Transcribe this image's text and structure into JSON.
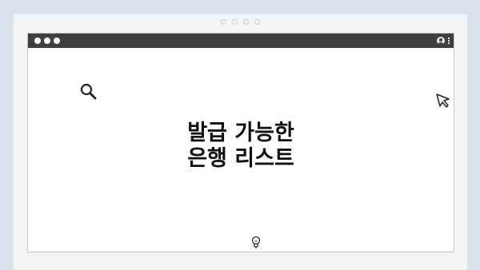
{
  "frame": {
    "dots_count": 4
  },
  "window": {
    "controls": [
      "close",
      "minimize",
      "maximize"
    ],
    "toolbar_icons": [
      "user-icon",
      "kebab-menu-icon"
    ]
  },
  "content": {
    "title_line1": "발급 가능한",
    "title_line2": "은행 리스트",
    "icons": [
      "search-icon",
      "cursor-arrow-icon",
      "lightbulb-icon"
    ]
  },
  "colors": {
    "background": "#d8e3ee",
    "frame": "#f4f4f4",
    "titlebar": "#3f3f3f",
    "window": "#ffffff",
    "text": "#111111"
  }
}
